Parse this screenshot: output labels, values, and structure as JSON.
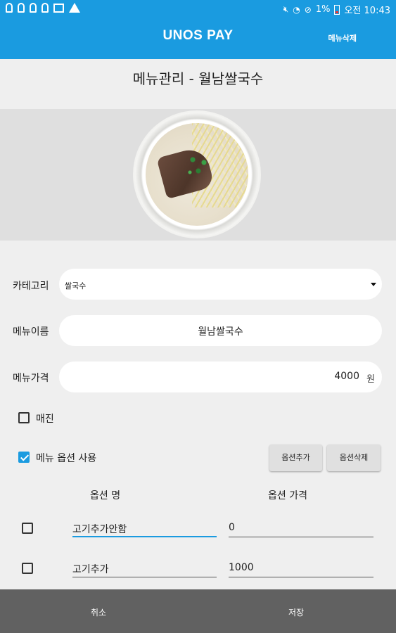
{
  "status_bar": {
    "battery": "1%",
    "time_text": "오전 10:43",
    "icons": [
      "key-icon",
      "key-icon",
      "key-icon",
      "key-icon",
      "image-icon",
      "warning-icon",
      "mute-icon",
      "wifi-icon",
      "no-disturb-icon",
      "battery-icon"
    ]
  },
  "appbar": {
    "title": "UNOS PAY",
    "delete_menu_label": "메뉴삭제"
  },
  "page": {
    "title": "메뉴관리 - 월남쌀국수"
  },
  "form": {
    "category_label": "카테고리",
    "category_value": "쌀국수",
    "name_label": "메뉴이름",
    "name_value": "월남쌀국수",
    "price_label": "메뉴가격",
    "price_value": "4000",
    "price_unit": "원"
  },
  "soldout": {
    "label": "매진",
    "checked": false
  },
  "menu_option": {
    "label": "메뉴 옵션 사용",
    "checked": true
  },
  "option_buttons": {
    "add_label": "옵션추가",
    "delete_label": "옵션삭제"
  },
  "options_table": {
    "name_header": "옵션 명",
    "price_header": "옵션 가격",
    "rows": [
      {
        "name": "고기추가안함",
        "price": "0"
      },
      {
        "name": "고기추가",
        "price": "1000"
      }
    ]
  },
  "bottom_bar": {
    "cancel_label": "취소",
    "save_label": "저장"
  },
  "colors": {
    "primary": "#1a9be0",
    "bottom_bar": "#616161",
    "background": "#efefef"
  }
}
